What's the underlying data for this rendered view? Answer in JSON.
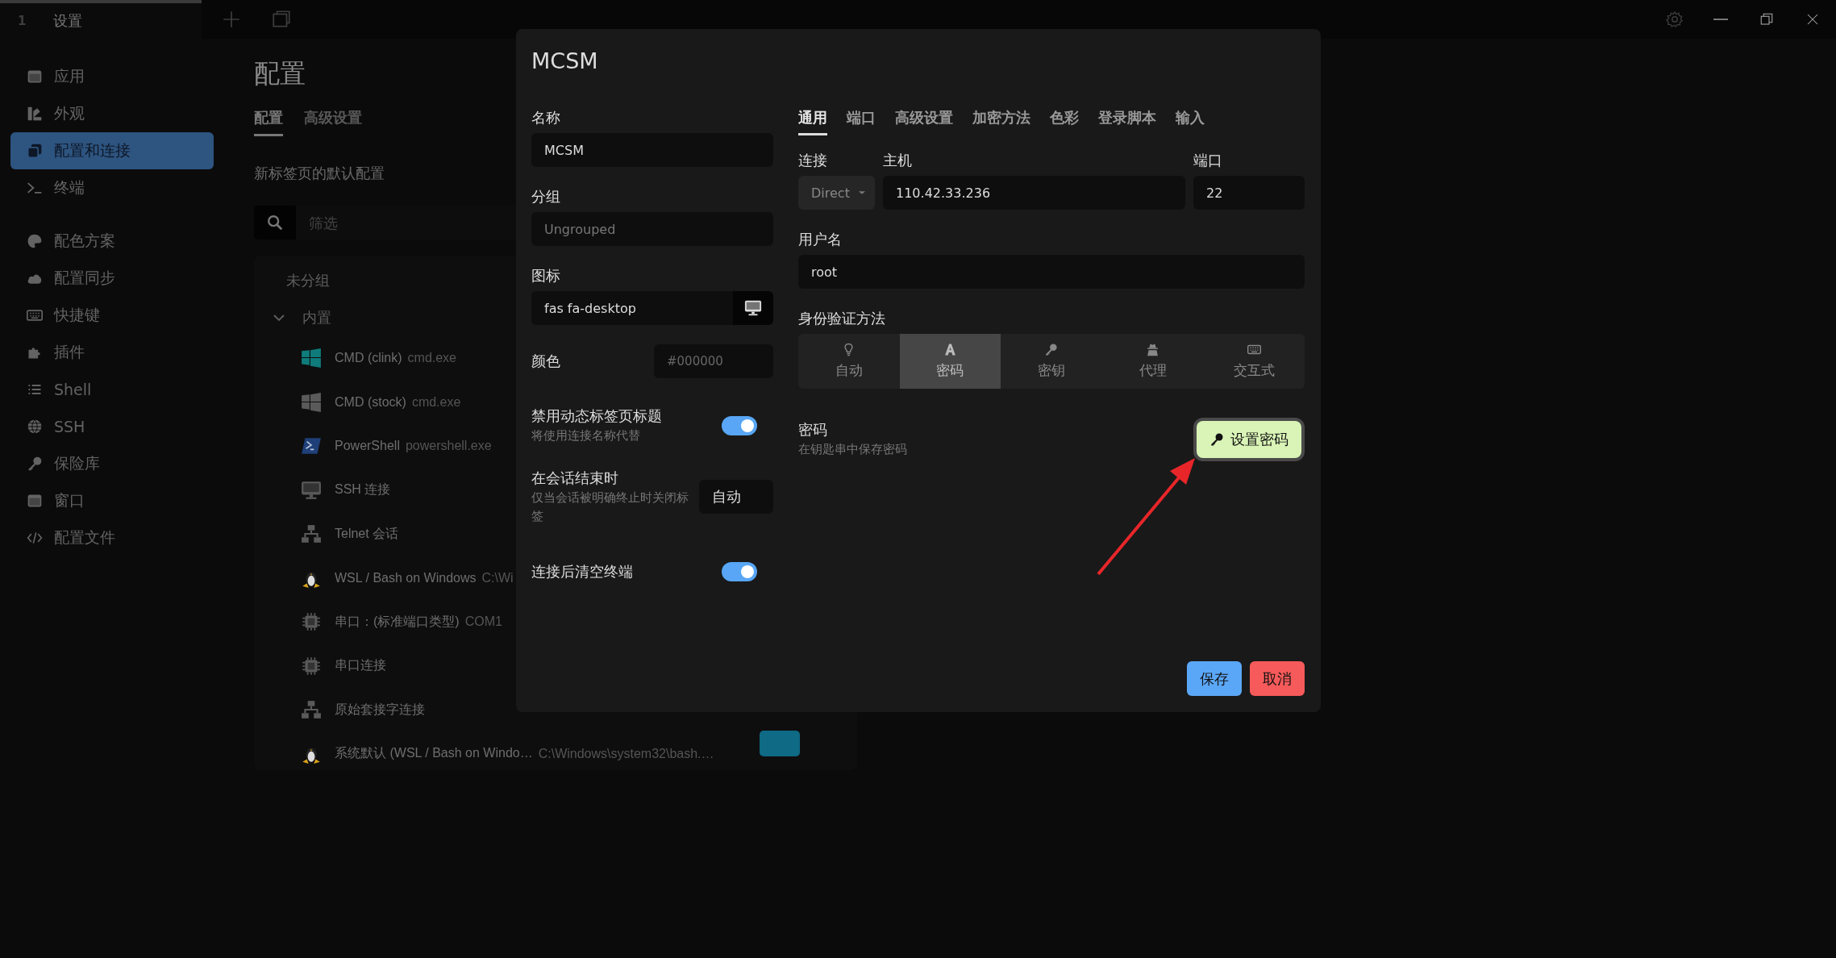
{
  "titlebar": {
    "tabs": [
      {
        "number": "1",
        "title": "设置",
        "selected": true
      }
    ]
  },
  "sidebar": {
    "groups": [
      [
        {
          "label": "应用",
          "selected": false
        },
        {
          "label": "外观",
          "selected": false
        },
        {
          "label": "配置和连接",
          "selected": true
        },
        {
          "label": "终端",
          "selected": false
        }
      ],
      [
        {
          "label": "配色方案",
          "selected": false
        },
        {
          "label": "配置同步",
          "selected": false
        },
        {
          "label": "快捷键",
          "selected": false
        },
        {
          "label": "插件",
          "selected": false
        },
        {
          "label": "Shell",
          "selected": false
        },
        {
          "label": "SSH",
          "selected": false
        },
        {
          "label": "保险库",
          "selected": false
        },
        {
          "label": "窗口",
          "selected": false
        },
        {
          "label": "配置文件",
          "selected": false
        }
      ]
    ]
  },
  "page": {
    "title": "配置",
    "tabs": [
      {
        "label": "配置",
        "selected": true
      },
      {
        "label": "高级设置",
        "selected": false
      }
    ],
    "section_title": "新标签页的默认配置",
    "filter": {
      "placeholder": "筛选"
    },
    "profile_groups": [
      {
        "label": "未分组"
      },
      {
        "label": "内置",
        "expanded": true,
        "profiles": [
          {
            "name": "CMD (clink)",
            "command": "cmd.exe"
          },
          {
            "name": "CMD (stock)",
            "command": "cmd.exe"
          },
          {
            "name": "PowerShell",
            "command": "powershell.exe"
          },
          {
            "name": "SSH 连接"
          },
          {
            "name": "Telnet 会话"
          },
          {
            "name": "WSL / Bash on Windows",
            "command": "C:\\Wi"
          },
          {
            "name": "串口：(标准端口类型)",
            "command": "COM1"
          },
          {
            "name": "串口连接"
          },
          {
            "name": "原始套接字连接"
          },
          {
            "name": "系统默认 (WSL / Bash on Windo…",
            "command": "C:\\Windows\\system32\\bash.…"
          }
        ]
      }
    ]
  },
  "dialog": {
    "title": "MCSM",
    "name": {
      "label": "名称",
      "value": "MCSM"
    },
    "group": {
      "label": "分组",
      "placeholder": "Ungrouped"
    },
    "icon": {
      "label": "图标",
      "value": "fas fa-desktop"
    },
    "color": {
      "label": "颜色",
      "placeholder": "#000000"
    },
    "toggles": [
      {
        "kind": "switch",
        "label": "禁用动态标签页标题",
        "hint": "将使用连接名称代替",
        "on": true
      },
      {
        "kind": "select",
        "label": "在会话结束时",
        "hint": "仅当会话被明确终止时关闭标签",
        "value": "自动"
      },
      {
        "kind": "switch",
        "label": "连接后清空终端",
        "on": true
      }
    ],
    "tabs": [
      {
        "label": "通用",
        "selected": true
      },
      {
        "label": "端口",
        "selected": false
      },
      {
        "label": "高级设置",
        "selected": false
      },
      {
        "label": "加密方法",
        "selected": false
      },
      {
        "label": "色彩",
        "selected": false
      },
      {
        "label": "登录脚本",
        "selected": false
      },
      {
        "label": "输入",
        "selected": false
      }
    ],
    "connection": {
      "label": "连接",
      "value": "Direct"
    },
    "host": {
      "label": "主机",
      "value": "110.42.33.236"
    },
    "port": {
      "label": "端口",
      "value": "22"
    },
    "username": {
      "label": "用户名",
      "value": "root"
    },
    "auth": {
      "label": "身份验证方法",
      "methods": [
        {
          "label": "自动",
          "selected": false
        },
        {
          "label": "密码",
          "selected": true
        },
        {
          "label": "密钥",
          "selected": false
        },
        {
          "label": "代理",
          "selected": false
        },
        {
          "label": "交互式",
          "selected": false
        }
      ]
    },
    "password": {
      "label": "密码",
      "hint": "在钥匙串中保存密码",
      "button": "设置密码"
    },
    "save": "保存",
    "cancel": "取消"
  }
}
